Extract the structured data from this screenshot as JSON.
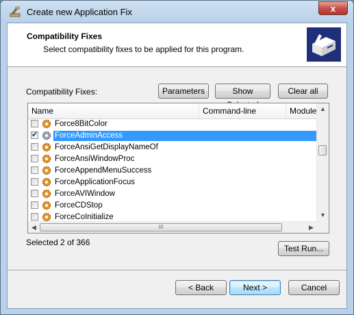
{
  "window": {
    "title": "Create new Application Fix",
    "close_glyph": "x"
  },
  "header": {
    "title": "Compatibility Fixes",
    "subtitle": "Select compatibility fixes to be applied for this program."
  },
  "fixes_label": "Compatibility Fixes:",
  "buttons": {
    "parameters": "Parameters",
    "show_selected": "Show Selected",
    "clear_all": "Clear all",
    "test_run": "Test Run...",
    "back": "< Back",
    "next": "Next >",
    "cancel": "Cancel"
  },
  "table": {
    "columns": [
      "Name",
      "Command-line",
      "Module"
    ],
    "rows": [
      {
        "name": "Force8BitColor",
        "checked": false,
        "selected": false
      },
      {
        "name": "ForceAdminAccess",
        "checked": true,
        "selected": true
      },
      {
        "name": "ForceAnsiGetDisplayNameOf",
        "checked": false,
        "selected": false
      },
      {
        "name": "ForceAnsiWindowProc",
        "checked": false,
        "selected": false
      },
      {
        "name": "ForceAppendMenuSuccess",
        "checked": false,
        "selected": false
      },
      {
        "name": "ForceApplicationFocus",
        "checked": false,
        "selected": false
      },
      {
        "name": "ForceAVIWindow",
        "checked": false,
        "selected": false
      },
      {
        "name": "ForceCDStop",
        "checked": false,
        "selected": false
      },
      {
        "name": "ForceCoInitialize",
        "checked": false,
        "selected": false
      }
    ],
    "scroll": {
      "up": "▲",
      "down": "▼",
      "left": "◀",
      "right": "▶",
      "grip": "III"
    }
  },
  "status": "Selected 2 of 366",
  "colors": {
    "selection": "#3399ff",
    "title_bg": "#b9d1ea",
    "close_red": "#c75050"
  },
  "icons": {
    "app": "wrench-hammer-icon",
    "wizard": "wizard-box-icon",
    "fix": "fix-gear-icon"
  }
}
